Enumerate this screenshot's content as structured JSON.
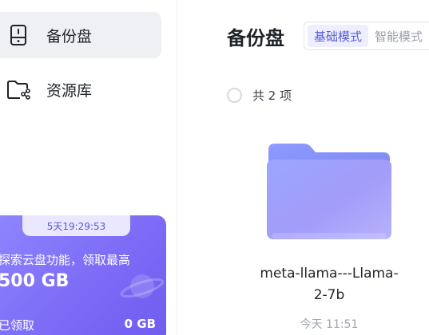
{
  "sidebar": {
    "items": [
      {
        "label": "备份盘",
        "icon": "backup-drive-icon",
        "active": true
      },
      {
        "label": "资源库",
        "icon": "shared-folder-icon",
        "active": false
      }
    ],
    "promo": {
      "countdown": "5天19:29:53",
      "headline": "探索云盘功能，领取最高",
      "amount": "500 GB",
      "claimed_label": "已领取",
      "claimed_value": "0 GB",
      "icon": "planet-icon"
    }
  },
  "main": {
    "title": "备份盘",
    "modes": [
      {
        "label": "基础模式",
        "active": true
      },
      {
        "label": "智能模式",
        "active": false
      }
    ],
    "select_all_text": "共 2 项",
    "files": [
      {
        "name": "meta-llama---Llama-2-7b",
        "time": "今天 11:51",
        "icon": "folder-icon"
      }
    ]
  },
  "colors": {
    "accent": "#5a5fd8",
    "promo_start": "#8f86ff",
    "promo_end": "#6e5cf0",
    "active_nav_bg": "#eef0f4"
  }
}
